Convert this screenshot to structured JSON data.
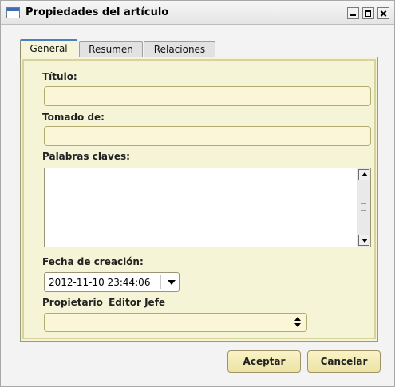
{
  "window": {
    "title": "Propiedades del artículo"
  },
  "tabs": [
    {
      "label": "General",
      "active": true
    },
    {
      "label": "Resumen",
      "active": false
    },
    {
      "label": "Relaciones",
      "active": false
    }
  ],
  "form": {
    "title_label": "Título:",
    "title_value": "",
    "taken_from_label": "Tomado de:",
    "taken_from_value": "",
    "keywords_label": "Palabras claves:",
    "keywords_value": "",
    "creation_date_label": "Fecha de creación:",
    "creation_date_value": "2012-11-10 23:44:06",
    "owner_label": "Propietario",
    "owner_value": "Editor Jefe",
    "owner_select_value": ""
  },
  "buttons": {
    "ok_label": "Aceptar",
    "cancel_label": "Cancelar"
  },
  "colors": {
    "panel_bg": "#f6f4d6",
    "field_bg": "#fcf6d8",
    "active_tab_accent": "#4a7fc0",
    "button_bg": "#f2e9b4"
  },
  "icons": {
    "window_icon": "window-icon",
    "minimize": "minimize-icon",
    "maximize": "maximize-icon",
    "close": "close-icon",
    "date_dropdown": "chevron-down-icon",
    "owner_select": "up-down-arrows-icon",
    "scroll_up": "arrow-up-icon",
    "scroll_down": "arrow-down-icon"
  }
}
